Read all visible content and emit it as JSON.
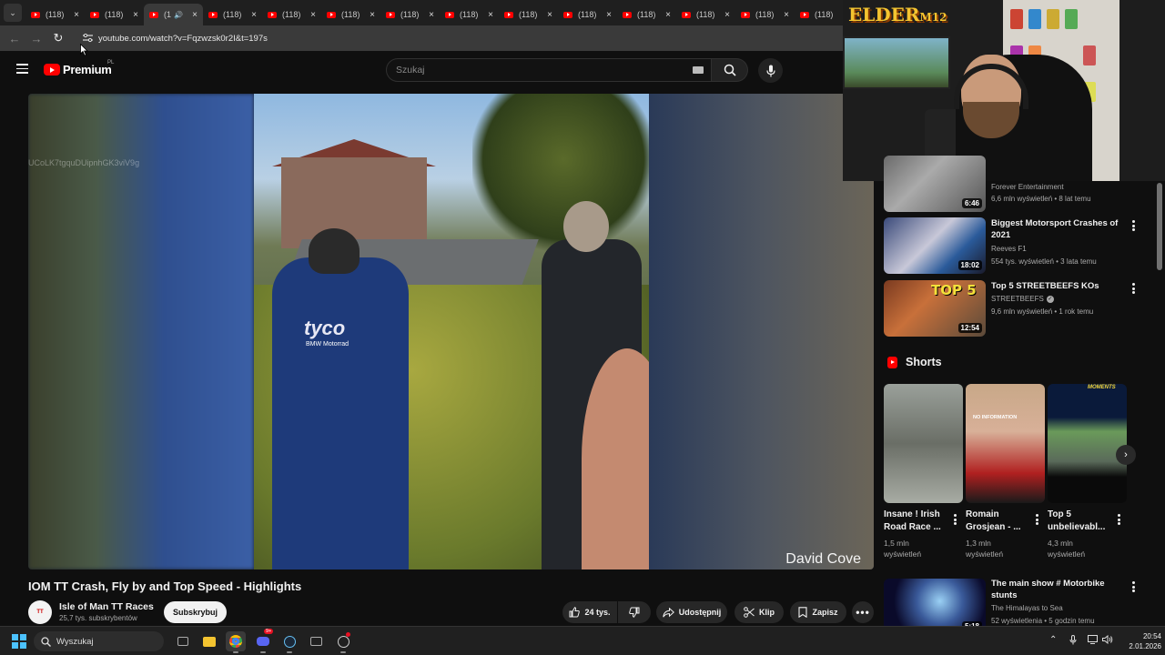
{
  "browser": {
    "tabs": [
      {
        "label": "(118)",
        "active": false
      },
      {
        "label": "(118)",
        "active": false
      },
      {
        "label": "(1",
        "active": true
      },
      {
        "label": "(118)",
        "active": false
      },
      {
        "label": "(118)",
        "active": false
      },
      {
        "label": "(118)",
        "active": false
      },
      {
        "label": "(118)",
        "active": false
      },
      {
        "label": "(118)",
        "active": false
      },
      {
        "label": "(118)",
        "active": false
      },
      {
        "label": "(118)",
        "active": false
      },
      {
        "label": "(118)",
        "active": false
      },
      {
        "label": "(118)",
        "active": false
      },
      {
        "label": "(118)",
        "active": false
      },
      {
        "label": "(118)",
        "active": false
      }
    ],
    "url": "youtube.com/watch?v=Fqzwzsk0r2I&t=197s"
  },
  "header": {
    "logo_text": "Premium",
    "region": "PL",
    "search_placeholder": "Szukaj"
  },
  "video": {
    "watermark_id": "UCoLK7tgquDUipnhGK3viV9g",
    "credit": "David Cove",
    "jersey_text": "tyco",
    "jersey_sub": "BMW Motorrad",
    "title": "IOM TT Crash, Fly by and Top Speed - Highlights",
    "channel": "Isle of Man TT Races",
    "subscribers": "25,7 tys. subskrybentów",
    "subscribe_label": "Subskrybuj",
    "likes": "24 tys.",
    "share_label": "Udostępnij",
    "clip_label": "Klip",
    "save_label": "Zapisz"
  },
  "overlay": {
    "brand": "ELDER",
    "brand_suffix": "M12"
  },
  "recommendations": [
    {
      "title": "",
      "channel": "Forever Entertainment",
      "meta": "6,6 mln wyświetleń • 8 lat temu",
      "duration": "6:46",
      "verified": false
    },
    {
      "title": "Biggest Motorsport Crashes of 2021",
      "channel": "Reeves F1",
      "meta": "554 tys. wyświetleń • 3 lata temu",
      "duration": "18:02",
      "verified": false
    },
    {
      "title": "Top 5 STREETBEEFS KOs",
      "channel": "STREETBEEFS",
      "meta": "9,6 mln wyświetleń • 1 rok temu",
      "duration": "12:54",
      "verified": true,
      "thumb_text": "TOP 5"
    },
    {
      "title": "The main show # Motorbike stunts",
      "channel": "The Himalayas to Sea",
      "meta": "52 wyświetlenia • 5 godzin temu",
      "duration": "5:18",
      "verified": false
    }
  ],
  "shorts": {
    "title": "Shorts",
    "items": [
      {
        "title": "Insane ! Irish Road Race ...",
        "views": "1,5 mln",
        "views_label": "wyświetleń"
      },
      {
        "title": "Romain Grosjean - ...",
        "views": "1,3 mln",
        "views_label": "wyświetleń",
        "thumb_text": "NO INFORMATION"
      },
      {
        "title": "Top 5 unbelievabl...",
        "views": "4,3 mln",
        "views_label": "wyświetleń",
        "thumb_text": "MOMENTS"
      }
    ]
  },
  "taskbar": {
    "search_label": "Wyszukaj",
    "discord_badge": "9+",
    "time": "20:54",
    "date": "2.01.2026"
  }
}
